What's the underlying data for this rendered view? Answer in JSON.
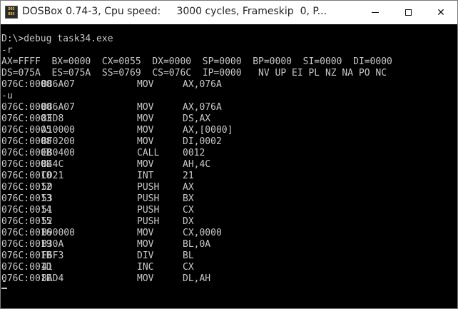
{
  "window": {
    "title": "DOSBox 0.74-3, Cpu speed:     3000 cycles, Frameskip  0, P...",
    "icon_name": "dosbox-icon",
    "icon_text": "DOS BOX",
    "buttons": [
      "minimize-icon",
      "maximize-icon",
      "close-icon"
    ],
    "close_glyph": "✕"
  },
  "console": {
    "header_lines": [
      "D:\\>debug task34.exe",
      "-r",
      "AX=FFFF  BX=0000  CX=0055  DX=0000  SP=0000  BP=0000  SI=0000  DI=0000",
      "DS=075A  ES=075A  SS=0769  CS=076C  IP=0000   NV UP EI PL NZ NA PO NC"
    ],
    "r_instruction": {
      "addr": "076C:0000",
      "hex": "B86A07",
      "mnemonic": "MOV",
      "operands": "AX,076A"
    },
    "u_command": "-u",
    "disassembly": [
      {
        "addr": "076C:0000",
        "hex": "B86A07",
        "mnemonic": "MOV",
        "operands": "AX,076A"
      },
      {
        "addr": "076C:0003",
        "hex": "8ED8",
        "mnemonic": "MOV",
        "operands": "DS,AX"
      },
      {
        "addr": "076C:0005",
        "hex": "A10000",
        "mnemonic": "MOV",
        "operands": "AX,[0000]"
      },
      {
        "addr": "076C:0008",
        "hex": "BF0200",
        "mnemonic": "MOV",
        "operands": "DI,0002"
      },
      {
        "addr": "076C:000B",
        "hex": "E80400",
        "mnemonic": "CALL",
        "operands": "0012"
      },
      {
        "addr": "076C:000E",
        "hex": "B44C",
        "mnemonic": "MOV",
        "operands": "AH,4C"
      },
      {
        "addr": "076C:0010",
        "hex": "CD21",
        "mnemonic": "INT",
        "operands": "21"
      },
      {
        "addr": "076C:0012",
        "hex": "50",
        "mnemonic": "PUSH",
        "operands": "AX"
      },
      {
        "addr": "076C:0013",
        "hex": "53",
        "mnemonic": "PUSH",
        "operands": "BX"
      },
      {
        "addr": "076C:0014",
        "hex": "51",
        "mnemonic": "PUSH",
        "operands": "CX"
      },
      {
        "addr": "076C:0015",
        "hex": "52",
        "mnemonic": "PUSH",
        "operands": "DX"
      },
      {
        "addr": "076C:0016",
        "hex": "B90000",
        "mnemonic": "MOV",
        "operands": "CX,0000"
      },
      {
        "addr": "076C:0019",
        "hex": "B30A",
        "mnemonic": "MOV",
        "operands": "BL,0A"
      },
      {
        "addr": "076C:001B",
        "hex": "F6F3",
        "mnemonic": "DIV",
        "operands": "BL"
      },
      {
        "addr": "076C:001D",
        "hex": "41",
        "mnemonic": "INC",
        "operands": "CX"
      },
      {
        "addr": "076C:001E",
        "hex": "8AD4",
        "mnemonic": "MOV",
        "operands": "DL,AH"
      }
    ],
    "prompt": "-"
  },
  "colors": {
    "console_bg": "#000000",
    "console_fg": "#c8c8c8",
    "titlebar_bg": "#ffffff"
  }
}
